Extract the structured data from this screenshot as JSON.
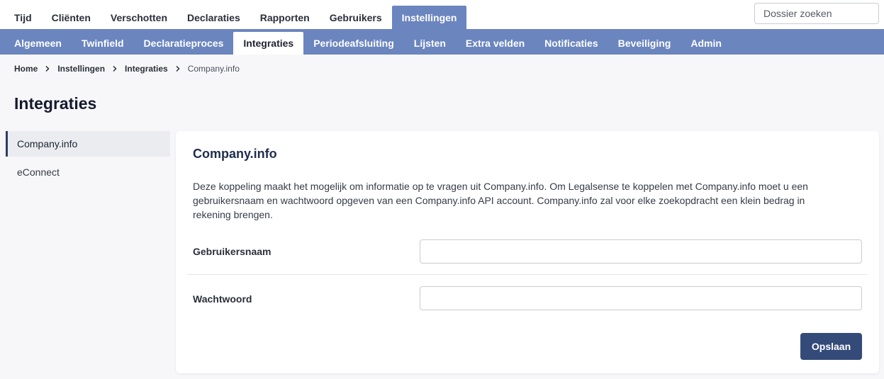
{
  "topnav": {
    "items": [
      {
        "label": "Tijd"
      },
      {
        "label": "Cliënten"
      },
      {
        "label": "Verschotten"
      },
      {
        "label": "Declaraties"
      },
      {
        "label": "Rapporten"
      },
      {
        "label": "Gebruikers"
      },
      {
        "label": "Instellingen",
        "active": true
      }
    ],
    "search_placeholder": "Dossier zoeken"
  },
  "subnav": {
    "items": [
      {
        "label": "Algemeen"
      },
      {
        "label": "Twinfield"
      },
      {
        "label": "Declaratieproces"
      },
      {
        "label": "Integraties",
        "active": true
      },
      {
        "label": "Periodeafsluiting"
      },
      {
        "label": "Lijsten"
      },
      {
        "label": "Extra velden"
      },
      {
        "label": "Notificaties"
      },
      {
        "label": "Beveiliging"
      },
      {
        "label": "Admin"
      }
    ]
  },
  "breadcrumb": {
    "items": [
      "Home",
      "Instellingen",
      "Integraties",
      "Company.info"
    ],
    "separator_icon": "chevron-right-icon"
  },
  "page": {
    "title": "Integraties"
  },
  "sidemenu": {
    "items": [
      {
        "label": "Company.info",
        "active": true
      },
      {
        "label": "eConnect"
      }
    ]
  },
  "card": {
    "title": "Company.info",
    "description": "Deze koppeling maakt het mogelijk om informatie op te vragen uit Company.info. Om Legalsense te koppelen met Company.info moet u een gebruikersnaam en wachtwoord opgeven van een Company.info API account. Company.info zal voor elke zoekopdracht een klein bedrag in rekening brengen.",
    "fields": {
      "username": {
        "label": "Gebruikersnaam",
        "value": ""
      },
      "password": {
        "label": "Wachtwoord",
        "value": ""
      }
    },
    "save_label": "Opslaan"
  },
  "colors": {
    "accent": "#6b85bf",
    "button": "#344a78",
    "active_border": "#2f3e63"
  }
}
